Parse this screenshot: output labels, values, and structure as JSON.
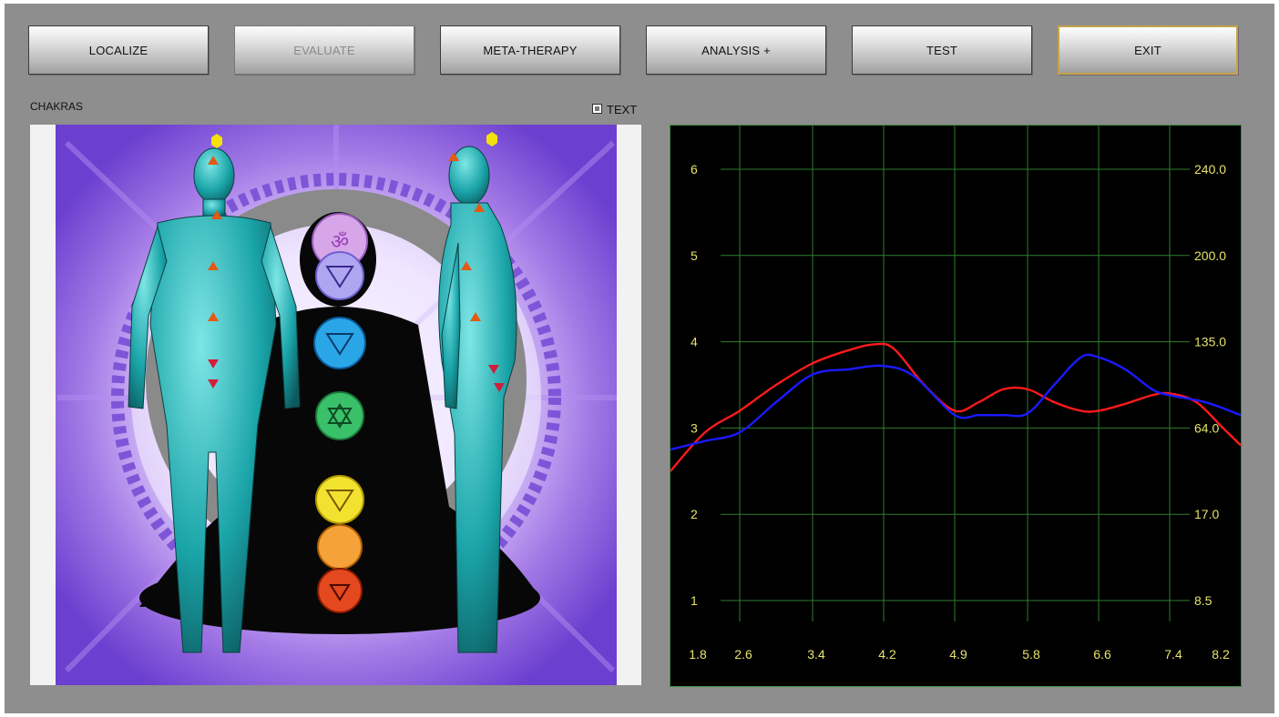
{
  "toolbar": {
    "buttons": [
      {
        "label": "LOCALIZE",
        "state": "normal"
      },
      {
        "label": "EVALUATE",
        "state": "disabled"
      },
      {
        "label": "META-THERAPY",
        "state": "normal"
      },
      {
        "label": "ANALYSIS +",
        "state": "normal"
      },
      {
        "label": "TEST",
        "state": "normal"
      },
      {
        "label": "EXIT",
        "state": "focused"
      }
    ]
  },
  "panel": {
    "title": "CHAKRAS",
    "text_checkbox_label": "TEXT",
    "text_checkbox_checked": false
  },
  "colors": {
    "accent": "#c7a24a",
    "grid": "#2f7d2f",
    "tick_text": "#e7e36a",
    "series_red": "#ff1a1a",
    "series_blue": "#1a1aff"
  },
  "chart_data": {
    "type": "line",
    "x_ticks": [
      "1.8",
      "2.6",
      "3.4",
      "4.2",
      "4.9",
      "5.8",
      "6.6",
      "7.4",
      "8.2"
    ],
    "y_ticks_left": [
      "1",
      "2",
      "3",
      "4",
      "5",
      "6"
    ],
    "y_ticks_right": [
      "8.5",
      "17.0",
      "64.0",
      "135.0",
      "200.0",
      "240.0"
    ],
    "xlim": [
      1.8,
      8.2
    ],
    "ylim": [
      1,
      6
    ],
    "grid": true,
    "series": [
      {
        "color": "#ff1a1a",
        "x": [
          1.8,
          2.2,
          2.6,
          3.0,
          3.4,
          3.8,
          4.1,
          4.3,
          4.6,
          4.9,
          5.2,
          5.5,
          5.8,
          6.1,
          6.4,
          6.6,
          6.9,
          7.2,
          7.4,
          7.7,
          8.0,
          8.2
        ],
        "y": [
          2.5,
          2.95,
          3.2,
          3.5,
          3.75,
          3.9,
          3.97,
          3.92,
          3.5,
          3.2,
          3.3,
          3.45,
          3.45,
          3.3,
          3.2,
          3.2,
          3.28,
          3.38,
          3.4,
          3.3,
          3.0,
          2.8
        ]
      },
      {
        "color": "#1a1aff",
        "x": [
          1.8,
          2.2,
          2.6,
          3.0,
          3.4,
          3.8,
          4.2,
          4.5,
          4.9,
          5.2,
          5.5,
          5.8,
          6.1,
          6.4,
          6.6,
          6.9,
          7.2,
          7.4,
          7.8,
          8.2
        ],
        "y": [
          2.75,
          2.85,
          2.95,
          3.3,
          3.62,
          3.68,
          3.72,
          3.6,
          3.15,
          3.15,
          3.15,
          3.17,
          3.5,
          3.82,
          3.82,
          3.68,
          3.45,
          3.38,
          3.3,
          3.15
        ]
      }
    ]
  }
}
